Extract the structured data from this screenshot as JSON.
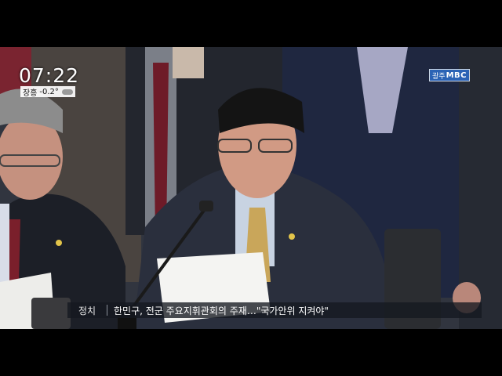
{
  "overlay": {
    "clock": "07:22",
    "weather": {
      "location": "장흥",
      "temperature": "-0.2°",
      "icon": "cloud-icon"
    },
    "logo": {
      "region": "광주",
      "brand": "MBC"
    },
    "ticker": {
      "category": "정치",
      "headline": "한민구, 전군 주요지휘관회의 주재…\"국가안위 지켜야\""
    }
  },
  "colors": {
    "letterbox": "#000000",
    "logo_blue": "#2b63b5",
    "ticker_bg": "#14181f",
    "tie_gold": "#c9a65a",
    "tie_red": "#7a1f2b"
  }
}
